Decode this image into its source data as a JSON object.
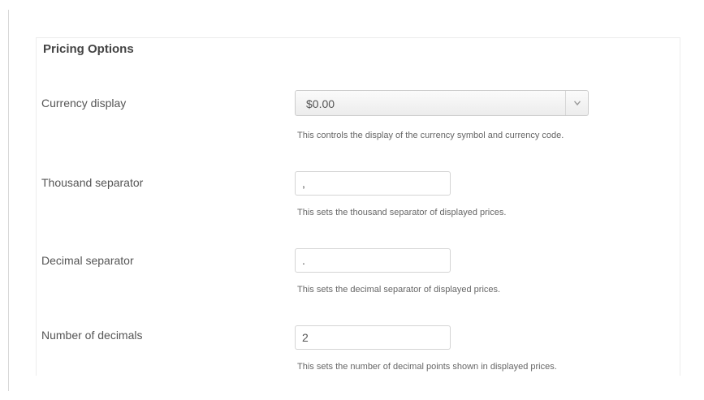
{
  "section": {
    "title": "Pricing Options"
  },
  "fields": {
    "currency_display": {
      "label": "Currency display",
      "selected": "$0.00",
      "help": "This controls the display of the currency symbol and currency code."
    },
    "thousand_separator": {
      "label": "Thousand separator",
      "value": ",",
      "help": "This sets the thousand separator of displayed prices."
    },
    "decimal_separator": {
      "label": "Decimal separator",
      "value": ".",
      "help": "This sets the decimal separator of displayed prices."
    },
    "number_of_decimals": {
      "label": "Number of decimals",
      "value": "2",
      "help": "This sets the number of decimal points shown in displayed prices."
    }
  },
  "icons": {
    "dropdown": "chevron-down-icon"
  }
}
